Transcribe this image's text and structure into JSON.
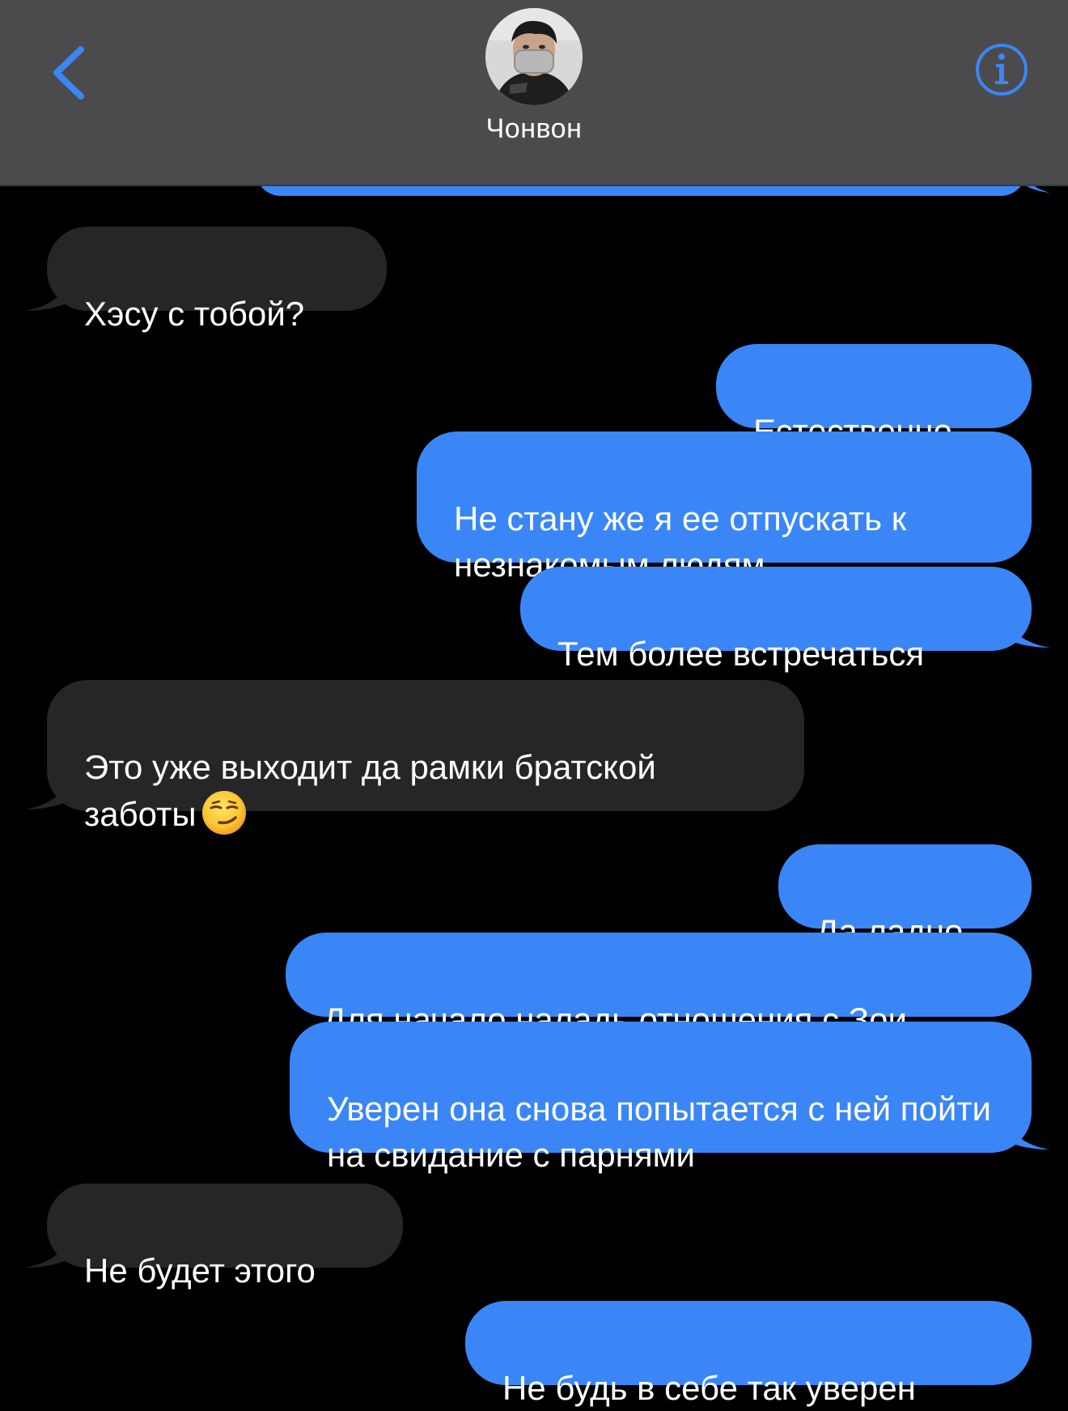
{
  "header": {
    "contact_name": "Чонвон",
    "back_icon": "chevron-left-icon",
    "info_icon": "info-icon",
    "accent": "#3a86f7"
  },
  "messages": [
    {
      "direction": "incoming",
      "text": "Хэсу с тобой?"
    },
    {
      "direction": "outgoing",
      "text": "Естественно"
    },
    {
      "direction": "outgoing",
      "text": "Не стану же я ее отпускать к незнакомым людям"
    },
    {
      "direction": "outgoing",
      "text": "Тем более встречаться"
    },
    {
      "direction": "incoming",
      "text": "Это уже выходит да рамки братской заботы",
      "emoji": "smirking-face"
    },
    {
      "direction": "outgoing",
      "text": "Да ладно"
    },
    {
      "direction": "outgoing",
      "text": "Для начало наладь отношения с Зои"
    },
    {
      "direction": "outgoing",
      "text": "Уверен она снова попытается с ней пойти на свидание с парнями"
    },
    {
      "direction": "incoming",
      "text": "Не будет этого"
    },
    {
      "direction": "outgoing",
      "text": "Не будь в себе так уверен"
    }
  ],
  "colors": {
    "incoming_bubble": "#262628",
    "outgoing_bubble": "#3a86f7",
    "header_bg": "#4b4b4d",
    "background": "#000000"
  }
}
